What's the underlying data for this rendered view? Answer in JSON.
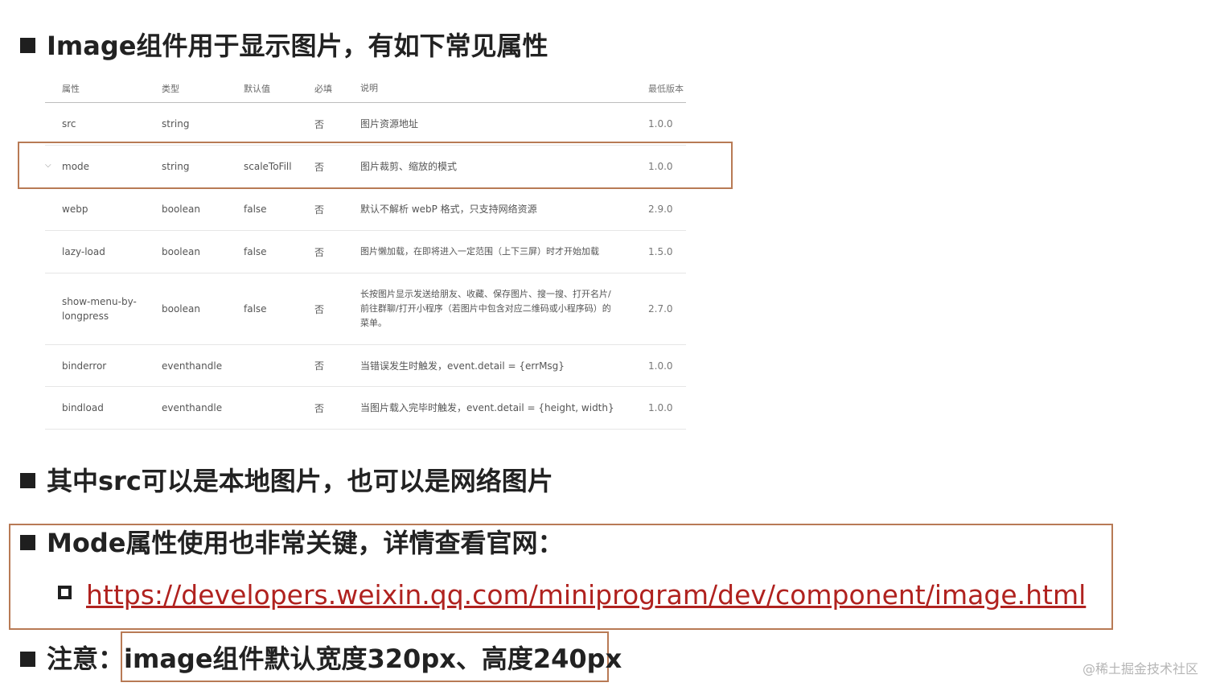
{
  "headings": {
    "h1": "Image组件用于显示图片，有如下常见属性",
    "h2": "其中src可以是本地图片，也可以是网络图片",
    "h3": "Mode属性使用也非常关键，详情查看官网：",
    "link": "https://developers.weixin.qq.com/miniprogram/dev/component/image.html",
    "note_label": "注意：",
    "note_text": "image组件默认宽度320px、高度240px"
  },
  "table": {
    "headers": {
      "attr": "属性",
      "type": "类型",
      "default": "默认值",
      "required": "必填",
      "desc": "说明",
      "version": "最低版本"
    },
    "rows": [
      {
        "attr": "src",
        "type": "string",
        "default": "",
        "required": "否",
        "desc": "图片资源地址",
        "version": "1.0.0"
      },
      {
        "attr": "mode",
        "type": "string",
        "default": "scaleToFill",
        "required": "否",
        "desc": "图片裁剪、缩放的模式",
        "version": "1.0.0"
      },
      {
        "attr": "webp",
        "type": "boolean",
        "default": "false",
        "required": "否",
        "desc": "默认不解析 webP 格式，只支持网络资源",
        "version": "2.9.0"
      },
      {
        "attr": "lazy-load",
        "type": "boolean",
        "default": "false",
        "required": "否",
        "desc": "图片懒加载，在即将进入一定范围（上下三屏）时才开始加载",
        "version": "1.5.0"
      },
      {
        "attr": "show-menu-by-longpress",
        "type": "boolean",
        "default": "false",
        "required": "否",
        "desc": "长按图片显示发送给朋友、收藏、保存图片、搜一搜、打开名片/前往群聊/打开小程序（若图片中包含对应二维码或小程序码）的菜单。",
        "version": "2.7.0"
      },
      {
        "attr": "binderror",
        "type": "eventhandle",
        "default": "",
        "required": "否",
        "desc": "当错误发生时触发，event.detail = {errMsg}",
        "version": "1.0.0"
      },
      {
        "attr": "bindload",
        "type": "eventhandle",
        "default": "",
        "required": "否",
        "desc": "当图片载入完毕时触发，event.detail = {height, width}",
        "version": "1.0.0"
      }
    ]
  },
  "watermark": "@稀土掘金技术社区",
  "colors": {
    "highlight_border": "#b87a55",
    "link": "#b0221f"
  }
}
